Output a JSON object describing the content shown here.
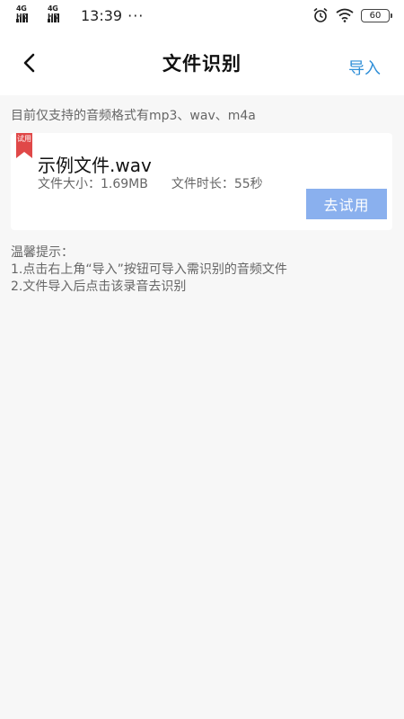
{
  "status_bar": {
    "signal1_label": "4G HD",
    "signal2_label": "4G HD",
    "time": "13:39",
    "more": "···",
    "battery": "60"
  },
  "nav": {
    "title": "文件识别",
    "import_label": "导入"
  },
  "support_text": "目前仅支持的音频格式有mp3、wav、m4a",
  "sample_card": {
    "ribbon_label": "试用",
    "file_name": "示例文件.wav",
    "size_text": "文件大小：1.69MB",
    "duration_text": "文件时长：55秒",
    "try_button_label": "去试用"
  },
  "tips": {
    "title": "温馨提示：",
    "line1": "1.点击右上角“导入”按钮可导入需识别的音频文件",
    "line2": "2.文件导入后点击该录音去识别"
  },
  "colors": {
    "accent": "#2f8fd8",
    "button": "#8ab0ee",
    "ribbon": "#e04848"
  }
}
